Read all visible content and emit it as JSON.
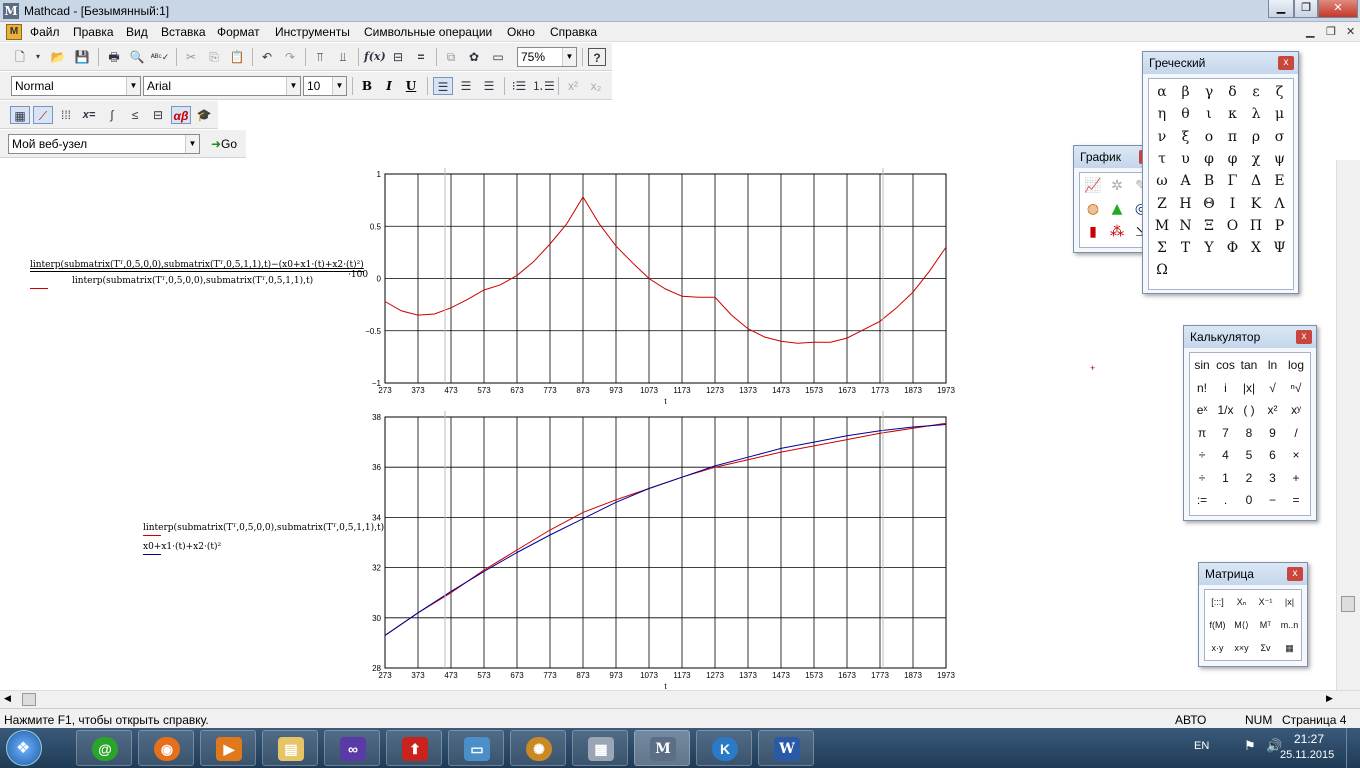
{
  "window": {
    "title": "Mathcad - [Безымянный:1]",
    "app_letter": "M"
  },
  "menu": [
    "Файл",
    "Правка",
    "Вид",
    "Вставка",
    "Формат",
    "Инструменты",
    "Символьные операции",
    "Окно",
    "Справка"
  ],
  "format_toolbar": {
    "style": "Normal",
    "font": "Arial",
    "size": "10",
    "bold": "B",
    "italic": "I",
    "underline": "U"
  },
  "standard_toolbar": {
    "zoom": "75%",
    "help": "?",
    "fx": "f(x)"
  },
  "web_toolbar": {
    "address": "Мой веб-узел",
    "go_label": "Go"
  },
  "math_toolbar": {
    "calc": "x="
  },
  "formula1": {
    "numerator": "linterp(submatrix(Tᵀ,0,5,0,0),submatrix(Tᵀ,0,5,1,1),t)−(x0+x1·(t)+x2·(t)²)",
    "denominator": "linterp(submatrix(Tᵀ,0,5,0,0),submatrix(Tᵀ,0,5,1,1),t)",
    "factor": "·100"
  },
  "formula2": {
    "line1": "linterp(submatrix(Tᵀ,0,5,0,0),submatrix(Tᵀ,0,5,1,1),t)",
    "line2": "x0+x1·(t)+x2·(t)²"
  },
  "chart_data": [
    {
      "type": "line",
      "xlabel": "t",
      "xlim": [
        273,
        1973
      ],
      "ylim": [
        -1,
        1
      ],
      "xticks": [
        273,
        373,
        473,
        573,
        673,
        773,
        873,
        973,
        1073,
        1173,
        1273,
        1373,
        1473,
        1573,
        1673,
        1773,
        1873,
        1973
      ],
      "yticks": [
        "1",
        "0.5",
        "0",
        "−0.5",
        "−1"
      ],
      "grid": true,
      "series": [
        {
          "color": "#cc0000",
          "x": [
            273,
            323,
            373,
            423,
            473,
            523,
            573,
            623,
            673,
            723,
            773,
            823,
            873,
            923,
            973,
            1023,
            1073,
            1123,
            1173,
            1223,
            1273,
            1323,
            1373,
            1423,
            1473,
            1523,
            1573,
            1623,
            1673,
            1723,
            1773,
            1823,
            1873,
            1923,
            1973
          ],
          "y": [
            -0.22,
            -0.31,
            -0.35,
            -0.34,
            -0.28,
            -0.2,
            -0.11,
            -0.06,
            0.03,
            0.16,
            0.33,
            0.52,
            0.78,
            0.52,
            0.31,
            0.15,
            0.0,
            -0.1,
            -0.17,
            -0.18,
            -0.18,
            -0.35,
            -0.48,
            -0.56,
            -0.6,
            -0.62,
            -0.61,
            -0.61,
            -0.57,
            -0.49,
            -0.41,
            -0.28,
            -0.13,
            0.07,
            0.3
          ]
        }
      ]
    },
    {
      "type": "line",
      "xlabel": "t",
      "xlim": [
        273,
        1973
      ],
      "ylim": [
        28,
        38
      ],
      "xticks": [
        273,
        373,
        473,
        573,
        673,
        773,
        873,
        973,
        1073,
        1173,
        1273,
        1373,
        1473,
        1573,
        1673,
        1773,
        1873,
        1973
      ],
      "yticks": [
        "38",
        "36",
        "34",
        "32",
        "30",
        "28"
      ],
      "grid": true,
      "series": [
        {
          "color": "#cc0000",
          "x": [
            273,
            373,
            473,
            573,
            673,
            773,
            873,
            973,
            1073,
            1173,
            1273,
            1373,
            1473,
            1573,
            1673,
            1773,
            1873,
            1973
          ],
          "y": [
            29.3,
            30.2,
            31.0,
            31.9,
            32.7,
            33.5,
            34.2,
            34.7,
            35.15,
            35.6,
            36.0,
            36.3,
            36.6,
            36.85,
            37.1,
            37.35,
            37.55,
            37.75
          ]
        },
        {
          "color": "#000099",
          "x": [
            273,
            373,
            473,
            573,
            673,
            773,
            873,
            973,
            1073,
            1173,
            1273,
            1373,
            1473,
            1573,
            1673,
            1773,
            1873,
            1973
          ],
          "y": [
            29.3,
            30.2,
            31.05,
            31.85,
            32.6,
            33.3,
            33.95,
            34.6,
            35.15,
            35.6,
            36.05,
            36.4,
            36.75,
            37.0,
            37.25,
            37.45,
            37.6,
            37.7
          ]
        }
      ]
    }
  ],
  "palettes": {
    "greek": {
      "title": "Греческий",
      "close": "x",
      "chars": [
        "α",
        "β",
        "γ",
        "δ",
        "ε",
        "ζ",
        "η",
        "θ",
        "ι",
        "κ",
        "λ",
        "μ",
        "ν",
        "ξ",
        "ο",
        "π",
        "ρ",
        "σ",
        "τ",
        "υ",
        "φ",
        "φ",
        "χ",
        "ψ",
        "ω",
        "Α",
        "Β",
        "Γ",
        "Δ",
        "Ε",
        "Ζ",
        "Η",
        "Θ",
        "Ι",
        "Κ",
        "Λ",
        "Μ",
        "Ν",
        "Ξ",
        "Ο",
        "Π",
        "Ρ",
        "Σ",
        "Τ",
        "Υ",
        "Φ",
        "Χ",
        "Ψ",
        "Ω"
      ]
    },
    "graph": {
      "title": "График",
      "close": "x"
    },
    "calc": {
      "title": "Калькулятор",
      "close": "x",
      "rows": [
        [
          "sin",
          "cos",
          "tan",
          "ln",
          "log"
        ],
        [
          "n!",
          "i",
          "|x|",
          "√",
          "ⁿ√"
        ],
        [
          "eˣ",
          "1/x",
          "( )",
          "x²",
          "xʸ"
        ],
        [
          "π",
          "7",
          "8",
          "9",
          "/"
        ],
        [
          "÷",
          "4",
          "5",
          "6",
          "×"
        ],
        [
          "÷",
          "1",
          "2",
          "3",
          "+"
        ],
        [
          ":=",
          ".",
          "0",
          "−",
          "="
        ]
      ]
    },
    "matrix": {
      "title": "Матрица",
      "close": "x",
      "buttons": [
        "[:::]",
        "Xₙ",
        "X⁻¹",
        "|x|",
        "f(M)",
        "M⟨⟩",
        "Mᵀ",
        "m..n",
        "x·y",
        "x×y",
        "Σv",
        "▦"
      ]
    }
  },
  "status": {
    "hint": "Нажмите F1, чтобы открыть справку.",
    "mode": "АВТО",
    "num": "NUM",
    "page": "Страница 4"
  },
  "taskbar": {
    "lang": "EN",
    "time": "21:27",
    "date": "25.11.2015"
  }
}
